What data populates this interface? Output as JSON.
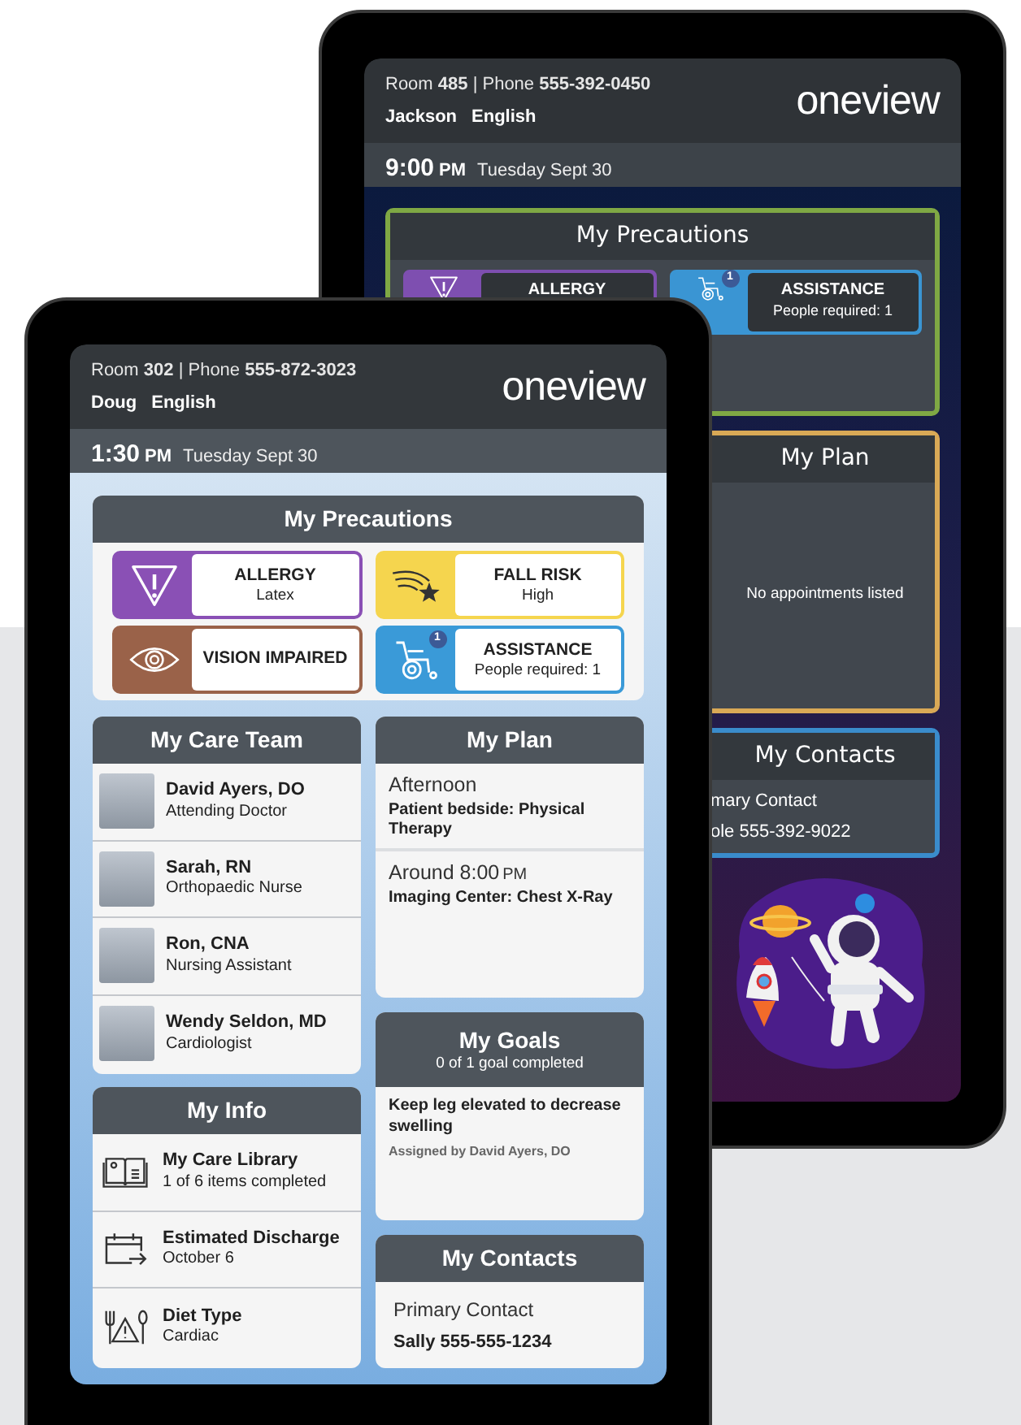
{
  "back_tablet": {
    "header": {
      "room_phone": "Room **485** | Phone **555-392-0450**",
      "patient": "Jackson",
      "language": "English",
      "logo": "oneview"
    },
    "time": {
      "time": "9:00",
      "meridiem": "PM",
      "date": "Tuesday Sept 30"
    },
    "precautions": {
      "title": "My Precautions",
      "items": [
        {
          "kind": "allergy",
          "label": "ALLERGY",
          "color": "#7e4fb0"
        },
        {
          "kind": "assistance",
          "label": "ASSISTANCE",
          "detail": "People required: 1",
          "badge": "1",
          "color": "#3a95d3"
        }
      ]
    },
    "plan": {
      "title": "My Plan",
      "empty_text": "No appointments listed"
    },
    "contacts": {
      "title": "My Contacts",
      "lines": [
        "mary Contact",
        "ole 555-392-9022"
      ]
    }
  },
  "front_tablet": {
    "header": {
      "room_phone": "Room **302** | Phone **555-872-3023**",
      "patient": "Doug",
      "language": "English",
      "logo": "oneview"
    },
    "time": {
      "time": "1:30",
      "meridiem": "PM",
      "date": "Tuesday Sept 30"
    },
    "precautions": {
      "title": "My Precautions",
      "items": [
        {
          "kind": "allergy",
          "label": "ALLERGY",
          "detail": "Latex",
          "color": "#8a50b5"
        },
        {
          "kind": "fall_risk",
          "label": "FALL RISK",
          "detail": "High",
          "color": "#f5d54e"
        },
        {
          "kind": "vision",
          "label": "VISION IMPAIRED",
          "color": "#9a6249"
        },
        {
          "kind": "assistance",
          "label": "ASSISTANCE",
          "detail": "People required: 1",
          "badge": "1",
          "color": "#3a9ad8"
        }
      ]
    },
    "care_team": {
      "title": "My Care Team",
      "members": [
        {
          "name": "David Ayers, DO",
          "role": "Attending Doctor"
        },
        {
          "name": "Sarah, RN",
          "role": "Orthopaedic Nurse"
        },
        {
          "name": "Ron, CNA",
          "role": "Nursing Assistant"
        },
        {
          "name": "Wendy Seldon, MD",
          "role": "Cardiologist"
        }
      ]
    },
    "plan": {
      "title": "My Plan",
      "entries": [
        {
          "time": "Afternoon",
          "detail": "Patient bedside: Physical Therapy"
        },
        {
          "time": "Around 8:00",
          "meridiem": "PM",
          "detail": "Imaging Center: Chest X-Ray"
        }
      ]
    },
    "goals": {
      "title": "My Goals",
      "summary": "0 of 1 goal completed",
      "items": [
        {
          "text": "Keep leg elevated to decrease swelling",
          "assigned": "Assigned by David Ayers, DO"
        }
      ]
    },
    "info": {
      "title": "My Info",
      "items": [
        {
          "kind": "library",
          "title": "My Care Library",
          "detail": "1 of 6 items completed"
        },
        {
          "kind": "discharge",
          "title": "Estimated Discharge",
          "detail": "October 6"
        },
        {
          "kind": "diet",
          "title": "Diet Type",
          "detail": "Cardiac"
        }
      ]
    },
    "contacts": {
      "title": "My Contacts",
      "label": "Primary Contact",
      "value": "Sally 555-555-1234"
    }
  }
}
